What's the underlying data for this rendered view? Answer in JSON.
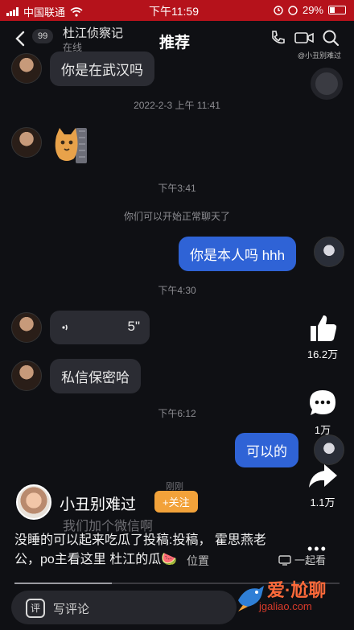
{
  "status_bar": {
    "carrier": "中国联通",
    "time": "下午11:59",
    "battery": "29%",
    "colors": {
      "background": "#b5121b"
    }
  },
  "header": {
    "back_badge": "99",
    "chat_name": "杜江侦察记",
    "chat_status": "在线",
    "title": "推荐",
    "watermark_tag": "@小丑别难过"
  },
  "messages": [
    {
      "side": "left",
      "text": "你是在武汉吗"
    },
    {
      "type": "time",
      "text": "2022-2-3 上午 11:41"
    },
    {
      "side": "left",
      "type": "sticker",
      "icon": "cat-sticker"
    },
    {
      "type": "time",
      "text": "下午3:41"
    },
    {
      "type": "system",
      "text": "你们可以开始正常聊天了"
    },
    {
      "side": "right",
      "text": "你是本人吗 hhh"
    },
    {
      "type": "time",
      "text": "下午4:30"
    },
    {
      "side": "left",
      "type": "voice",
      "duration": "5\""
    },
    {
      "side": "left",
      "text": "私信保密哈"
    },
    {
      "type": "time",
      "text": "下午6:12"
    },
    {
      "side": "right",
      "text": "可以的"
    }
  ],
  "actions": {
    "likes": "16.2万",
    "comments": "1万",
    "shares": "1.1万"
  },
  "overlay": {
    "author": "小丑别难过",
    "follow_label": "+关注",
    "faint_time": "刚刚",
    "faint_message": "我们加个微信啊",
    "caption": "没睡的可以起来吃瓜了投稿:投稿， 霍思燕老公，po主看这里 杜江的瓜🍉",
    "location": "位置",
    "watch_together": "一起看",
    "more": "•••",
    "progress": 0.3,
    "comment_placeholder": "写评论",
    "comment_icon_text": "评"
  },
  "site_watermark": {
    "name": "爱·尬聊",
    "url": "jgaliao.com"
  }
}
